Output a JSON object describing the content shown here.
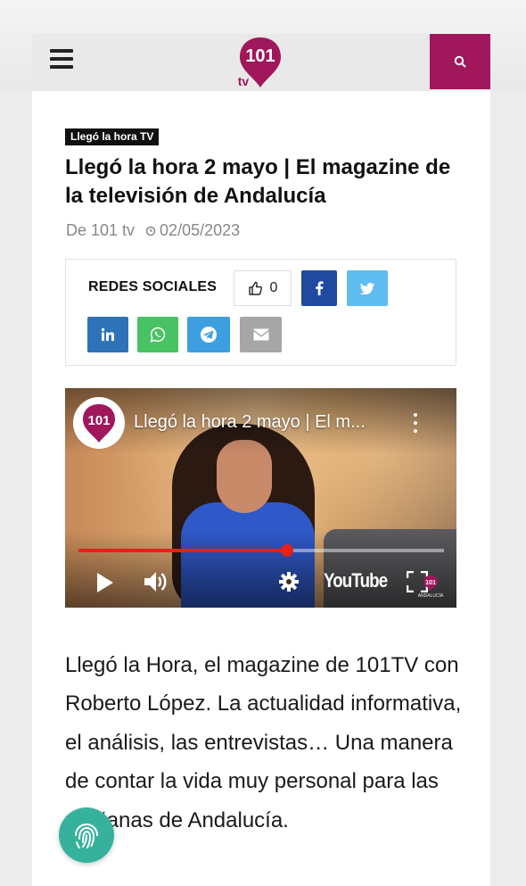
{
  "header": {
    "menu_icon": "hamburger-icon",
    "logo_text": "101",
    "logo_sub": "tv",
    "search_icon": "search-icon",
    "accent_color": "#a0175c"
  },
  "article": {
    "category": "Llegó la hora TV",
    "title": "Llegó la hora 2 mayo | El magazine de la televisión de Andalucía",
    "author": "De 101 tv",
    "date": "02/05/2023",
    "body": "Llegó la Hora, el magazine de 101TV con Roberto López. La actualidad informativa, el análisis, las entrevistas… Una manera de contar la vida muy personal para las mañanas de Andalucía."
  },
  "social": {
    "label": "REDES SOCIALES",
    "like_count": "0",
    "buttons": [
      {
        "name": "facebook",
        "icon": "facebook-icon",
        "color": "#1f4aa0"
      },
      {
        "name": "twitter",
        "icon": "twitter-icon",
        "color": "#5fbcf0"
      },
      {
        "name": "linkedin",
        "icon": "linkedin-icon",
        "color": "#2e73b8"
      },
      {
        "name": "whatsapp",
        "icon": "whatsapp-icon",
        "color": "#49c264"
      },
      {
        "name": "telegram",
        "icon": "telegram-icon",
        "color": "#3d9fe0"
      },
      {
        "name": "email",
        "icon": "mail-icon",
        "color": "#a6a6a6"
      }
    ]
  },
  "video": {
    "title": "Llegó la hora 2 mayo | El m...",
    "progress": 0.57,
    "channel_logo": "101",
    "youtube_label": "YouTube",
    "corner_logo": "101",
    "corner_sub": "ANDALUCÍA"
  }
}
